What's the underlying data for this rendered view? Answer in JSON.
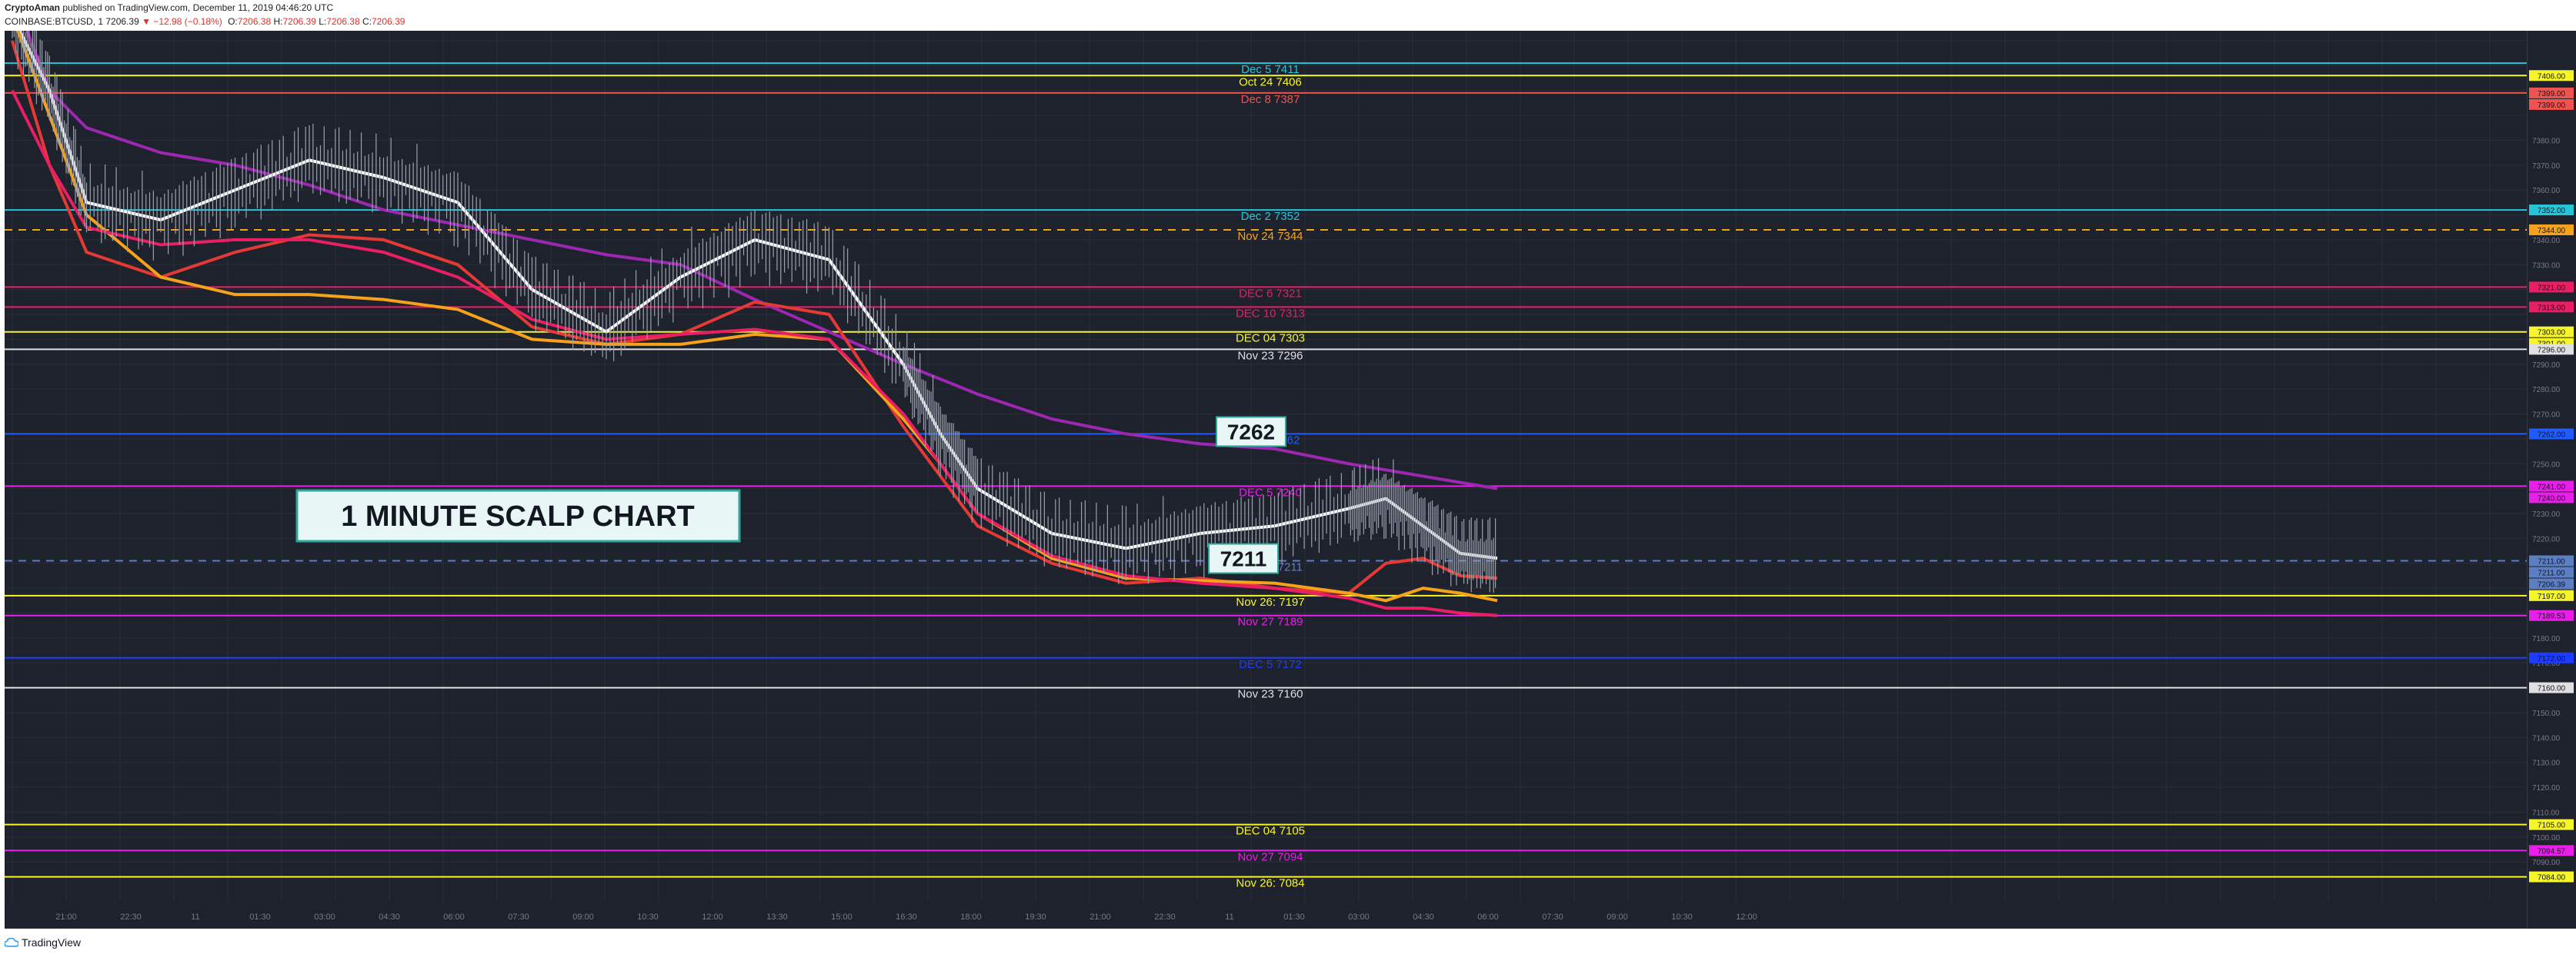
{
  "header": {
    "author": "CryptoAman",
    "published": "published on TradingView.com, December 11, 2019 04:46:20 UTC",
    "symbol": "COINBASE:BTCUSD, 1",
    "last": "7206.39",
    "change": "−12.98 (−0.18%)",
    "o": "7206.38",
    "h": "7206.39",
    "l": "7206.38",
    "c": "7206.39"
  },
  "footer": {
    "brand": "TradingView"
  },
  "colors": {
    "bg": "#1e222d",
    "grid": "#2a2e39",
    "white": "#ffffff",
    "red": "#e53935",
    "orange": "#f7a21b",
    "purple": "#9c27b0",
    "cyan": "#26c6da",
    "yellow": "#f5f52a",
    "magenta": "#e91ee9",
    "blue": "#1e3cff",
    "pink": "#e91e63"
  },
  "chart_data": {
    "type": "line",
    "ylim": [
      7074,
      7424
    ],
    "x_ticks": [
      "21:00",
      "22:30",
      "11",
      "01:30",
      "03:00",
      "04:30",
      "06:00",
      "07:30",
      "09:00",
      "10:30",
      "12:00",
      "13:30",
      "15:00",
      "16:30",
      "18:00",
      "19:30",
      "21:00",
      "22:30",
      "11",
      "01:30",
      "03:00",
      "04:30",
      "06:00",
      "07:30",
      "09:00",
      "10:30",
      "12:00"
    ],
    "y_ticks": [
      7380,
      7370,
      7360,
      7340,
      7330,
      7290,
      7280,
      7270,
      7250,
      7230,
      7220,
      7190,
      7180,
      7170,
      7150,
      7140,
      7130,
      7120,
      7110,
      7100,
      7090
    ],
    "title_box": "1 MINUTE SCALP CHART",
    "callouts": [
      {
        "text": "7262",
        "price": 7262
      },
      {
        "text": "7211",
        "price": 7211
      }
    ],
    "levels": [
      {
        "label": "Dec 5 7411",
        "price": 7411,
        "color": "#26c6da"
      },
      {
        "label": "Oct 24 7406",
        "price": 7406,
        "color": "#f5f52a",
        "axis": "7406.00"
      },
      {
        "label": "Dec 8 7387",
        "price": 7399,
        "color": "#ef5350",
        "axis": "7399.00",
        "axis2": "7399.00"
      },
      {
        "label": "Dec 2 7352",
        "price": 7352,
        "color": "#26c6da",
        "axis": "7352.00"
      },
      {
        "label": "Nov 24 7344",
        "price": 7344,
        "color": "#f7a21b",
        "dashed": true,
        "axis": "7344.00"
      },
      {
        "label": "DEC 6 7321",
        "price": 7321,
        "color": "#e91e63",
        "axis": "7321.00"
      },
      {
        "label": "DEC 10 7313",
        "price": 7313,
        "color": "#e91e63",
        "axis": "7313.00"
      },
      {
        "label": "DEC 04 7303",
        "price": 7303,
        "color": "#f5f52a",
        "axis": "7303.00",
        "axis2": "7301.00"
      },
      {
        "label": "Nov 23 7296",
        "price": 7296,
        "color": "#e0e0e0",
        "axis": "7296.00"
      },
      {
        "label": "Dec 3 7262",
        "price": 7262,
        "color": "#1e5cff",
        "axis": "7262.00"
      },
      {
        "label": "DEC 5 7240",
        "price": 7241,
        "color": "#e91ee9",
        "axis": "7241.00",
        "axis2": "7240.00"
      },
      {
        "label": "Nov 22 7211",
        "price": 7211,
        "color": "#5c7fc4",
        "dashed": true,
        "axis": "7211.00",
        "axis2": "7211.00",
        "axis3": "7206.39",
        "axis4": "00:47"
      },
      {
        "label": "Nov 26: 7197",
        "price": 7197,
        "color": "#f5f52a",
        "axis": "7197.00"
      },
      {
        "label": "Nov 27 7189",
        "price": 7189,
        "color": "#e91ee9",
        "axis": "7189.53"
      },
      {
        "label": "DEC 5 7172",
        "price": 7172,
        "color": "#1e3cff",
        "axis": "7172.00"
      },
      {
        "label": "Nov 23 7160",
        "price": 7160,
        "color": "#e0e0e0",
        "axis": "7160.00"
      },
      {
        "label": "DEC 04 7105",
        "price": 7105,
        "color": "#f5f52a",
        "axis": "7105.00"
      },
      {
        "label": "Nov 27 7094",
        "price": 7094.57,
        "color": "#e91ee9",
        "axis": "7094.57"
      },
      {
        "label": "Nov 26: 7084",
        "price": 7084,
        "color": "#f5f52a",
        "axis": "7084.00"
      }
    ],
    "series": [
      {
        "name": "",
        "color": "#9c27b0",
        "x": [
          0,
          5,
          10,
          20,
          30,
          40,
          50,
          60,
          70,
          80,
          90,
          100,
          110,
          120,
          130,
          140,
          150,
          160,
          170,
          180,
          190,
          200
        ],
        "y": [
          7440,
          7400,
          7385,
          7375,
          7370,
          7362,
          7352,
          7346,
          7340,
          7334,
          7330,
          7316,
          7303,
          7290,
          7278,
          7268,
          7262,
          7258,
          7256,
          7250,
          7245,
          7240
        ]
      },
      {
        "name": "",
        "color": "#ffffff",
        "x": [
          0,
          5,
          10,
          20,
          30,
          40,
          50,
          60,
          70,
          80,
          90,
          100,
          110,
          120,
          125,
          130,
          140,
          150,
          160,
          170,
          180,
          185,
          190,
          195,
          200
        ],
        "y": [
          7430,
          7400,
          7355,
          7348,
          7360,
          7372,
          7365,
          7355,
          7320,
          7303,
          7325,
          7340,
          7332,
          7290,
          7262,
          7240,
          7222,
          7216,
          7222,
          7225,
          7232,
          7236,
          7225,
          7214,
          7212
        ]
      },
      {
        "name": "",
        "color": "#e53935",
        "x": [
          0,
          5,
          10,
          20,
          30,
          40,
          50,
          60,
          70,
          80,
          90,
          100,
          110,
          120,
          125,
          130,
          140,
          150,
          160,
          170,
          180,
          185,
          190,
          195,
          200
        ],
        "y": [
          7420,
          7370,
          7335,
          7325,
          7335,
          7342,
          7340,
          7330,
          7305,
          7298,
          7302,
          7315,
          7310,
          7265,
          7245,
          7225,
          7210,
          7202,
          7204,
          7200,
          7198,
          7210,
          7212,
          7205,
          7204
        ]
      },
      {
        "name": "",
        "color": "#f7a21b",
        "x": [
          0,
          5,
          10,
          20,
          30,
          40,
          50,
          60,
          70,
          80,
          90,
          100,
          110,
          120,
          125,
          130,
          140,
          150,
          160,
          170,
          180,
          185,
          190,
          195,
          200
        ],
        "y": [
          7430,
          7390,
          7350,
          7325,
          7318,
          7318,
          7316,
          7312,
          7300,
          7298,
          7298,
          7302,
          7300,
          7268,
          7250,
          7230,
          7212,
          7204,
          7203,
          7202,
          7198,
          7195,
          7200,
          7198,
          7195
        ]
      },
      {
        "name": "",
        "color": "#e91e63",
        "x": [
          0,
          5,
          10,
          20,
          30,
          40,
          50,
          60,
          70,
          80,
          90,
          100,
          110,
          120,
          125,
          130,
          140,
          150,
          160,
          170,
          180,
          185,
          190,
          195,
          200
        ],
        "y": [
          7400,
          7370,
          7345,
          7338,
          7340,
          7340,
          7335,
          7325,
          7308,
          7300,
          7302,
          7304,
          7300,
          7270,
          7250,
          7230,
          7213,
          7205,
          7202,
          7200,
          7196,
          7192,
          7192,
          7190,
          7189
        ]
      }
    ]
  }
}
